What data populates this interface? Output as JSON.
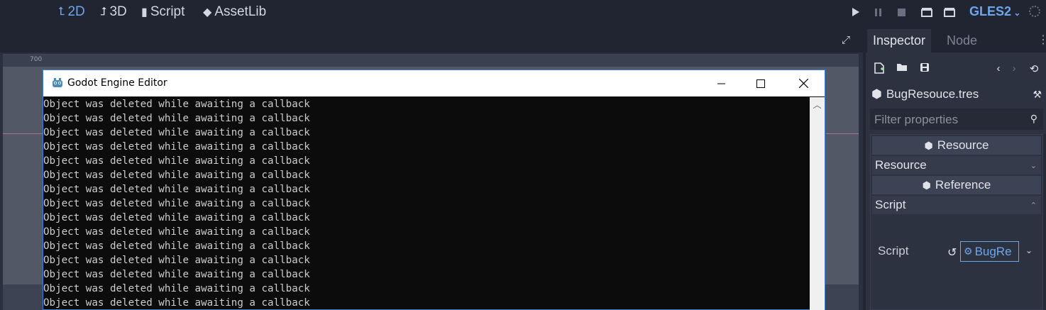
{
  "workspaces": {
    "w2d": "2D",
    "w3d": "3D",
    "script": "Script",
    "assetlib": "AssetLib"
  },
  "renderer": "GLES2",
  "ruler": {
    "label": "700"
  },
  "console": {
    "title": "Godot Engine Editor",
    "lines": [
      "Object was deleted while awaiting a callback",
      "Object was deleted while awaiting a callback",
      "Object was deleted while awaiting a callback",
      "Object was deleted while awaiting a callback",
      "Object was deleted while awaiting a callback",
      "Object was deleted while awaiting a callback",
      "Object was deleted while awaiting a callback",
      "Object was deleted while awaiting a callback",
      "Object was deleted while awaiting a callback",
      "Object was deleted while awaiting a callback",
      "Object was deleted while awaiting a callback",
      "Object was deleted while awaiting a callback",
      "Object was deleted while awaiting a callback",
      "Object was deleted while awaiting a callback",
      "Object was deleted while awaiting a callback"
    ]
  },
  "inspector": {
    "tab_inspector": "Inspector",
    "tab_node": "Node",
    "resource_name": "BugResouce.tres",
    "filter_placeholder": "Filter properties",
    "cat_resource": "Resource",
    "sub_resource": "Resource",
    "cat_reference": "Reference",
    "sub_script": "Script",
    "prop_script": "Script",
    "script_value": "BugRe"
  },
  "colors": {
    "accent": "#6ea6ee",
    "background": "#202531",
    "panel": "#2c3240"
  }
}
